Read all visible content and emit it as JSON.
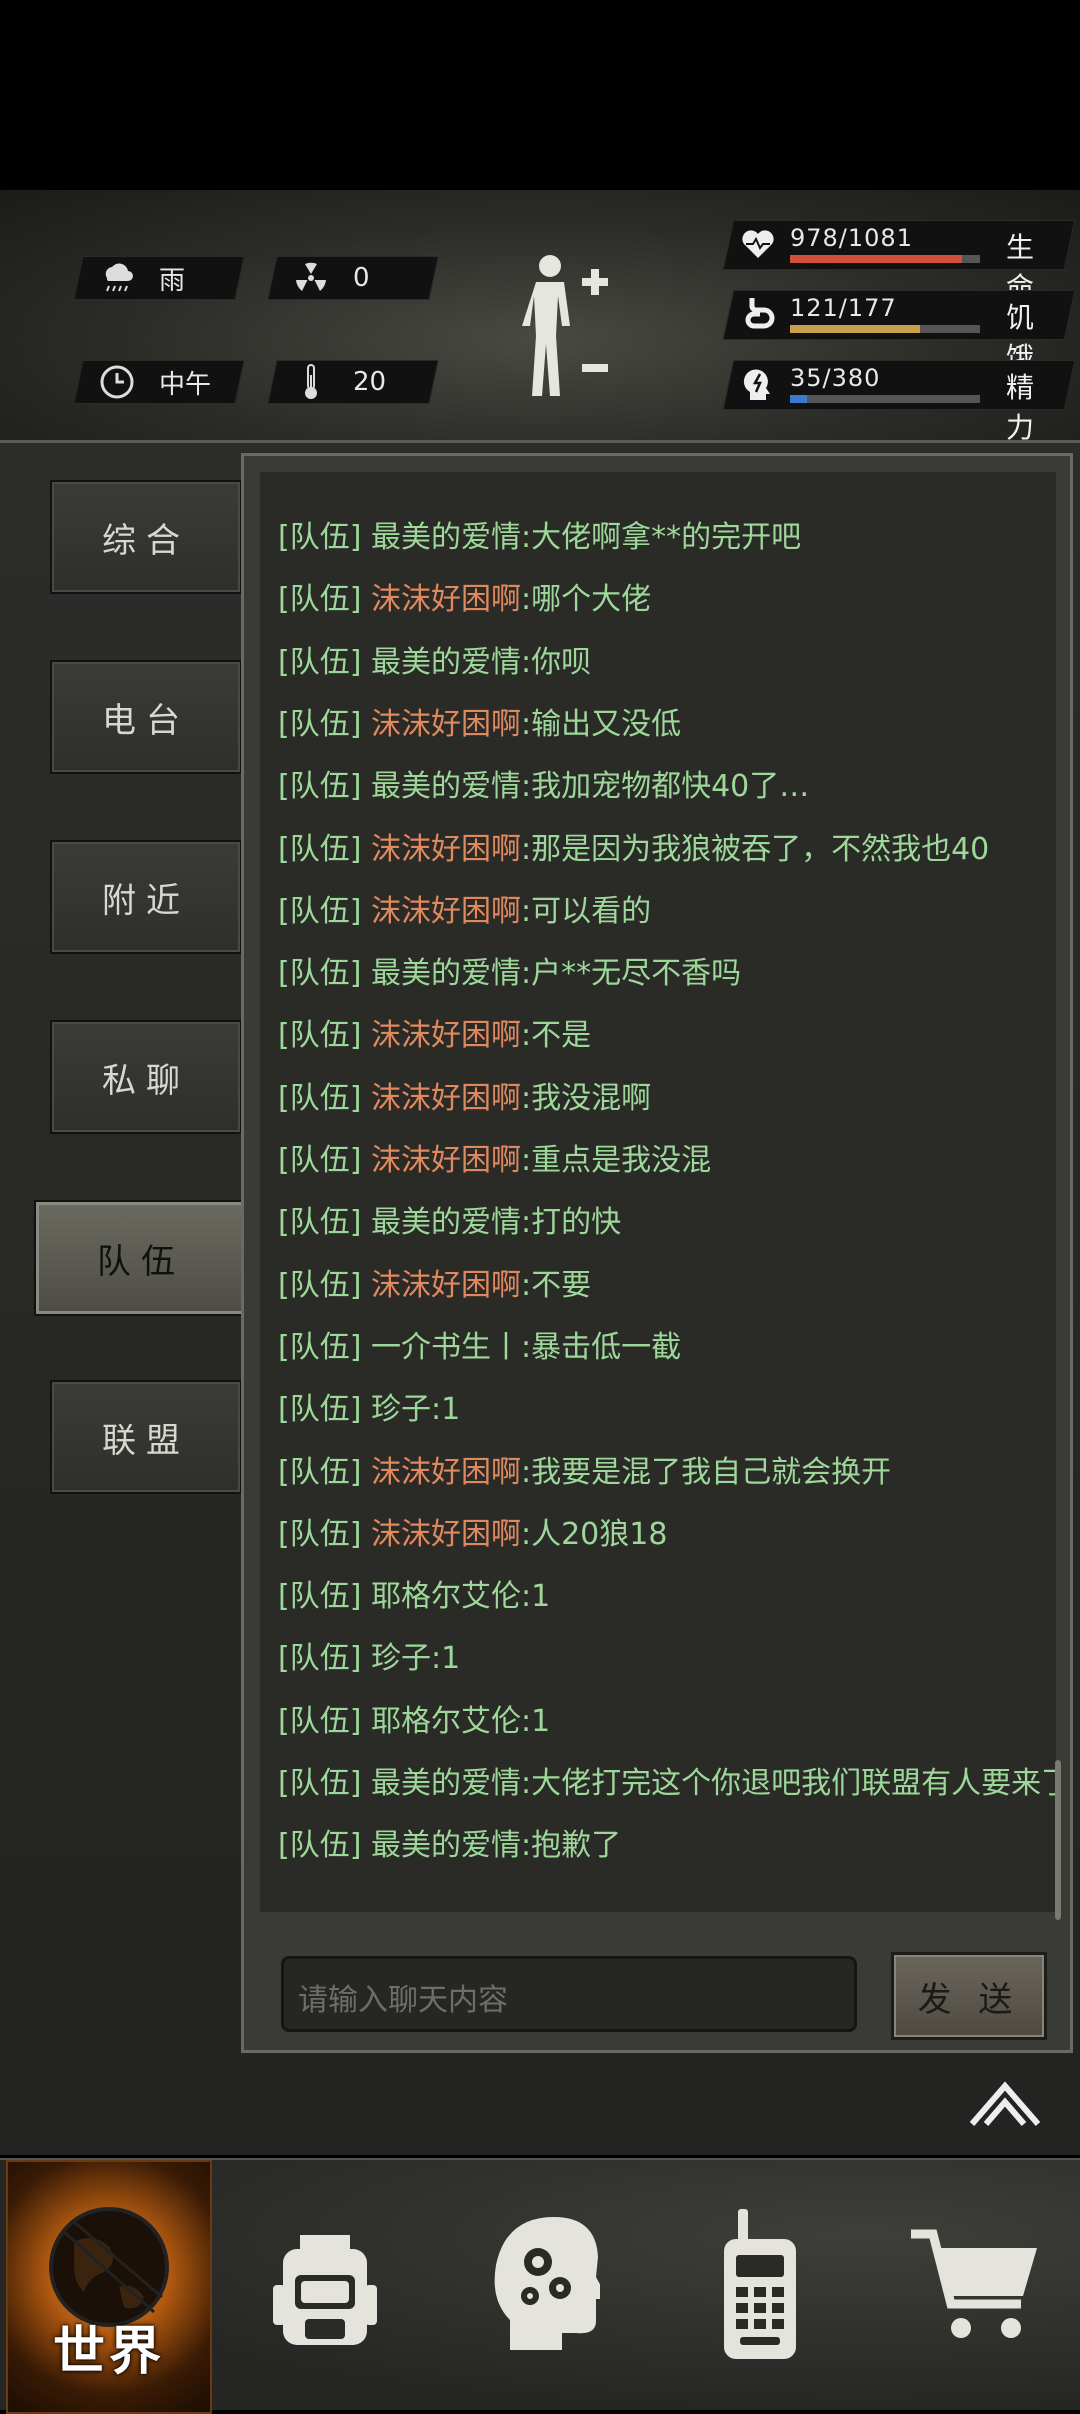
{
  "hud": {
    "weather": "雨",
    "radiation": "0",
    "time_of_day": "中午",
    "temperature": "20",
    "stats": [
      {
        "value": "978/1081",
        "label": "生命",
        "fraction": 0.905,
        "color": "#d0503a",
        "icon": "heart-icon"
      },
      {
        "value": "121/177",
        "label": "饥饿",
        "fraction": 0.684,
        "color": "#c9a04c",
        "icon": "stomach-icon"
      },
      {
        "value": "35/380",
        "label": "精力",
        "fraction": 0.092,
        "color": "#3a7bd0",
        "icon": "energy-head-icon"
      }
    ]
  },
  "tabs": [
    "综合",
    "电台",
    "附近",
    "私聊",
    "队伍",
    "联盟"
  ],
  "active_tab": "队伍",
  "messages": [
    {
      "channel": "[队伍]",
      "name": "最美的爱情",
      "text": ":大佬啊拿**的完开吧",
      "name_color": "green"
    },
    {
      "channel": "[队伍]",
      "name": "沫沫好困啊",
      "text": ":哪个大佬",
      "name_color": "orange"
    },
    {
      "channel": "[队伍]",
      "name": "最美的爱情",
      "text": ":你呗",
      "name_color": "green"
    },
    {
      "channel": "[队伍]",
      "name": "沫沫好困啊",
      "text": ":输出又没低",
      "name_color": "orange"
    },
    {
      "channel": "[队伍]",
      "name": "最美的爱情",
      "text": ":我加宠物都快40了…",
      "name_color": "green"
    },
    {
      "channel": "[队伍]",
      "name": "沫沫好困啊",
      "text": ":那是因为我狼被吞了，不然我也40",
      "name_color": "orange"
    },
    {
      "channel": "[队伍]",
      "name": "沫沫好困啊",
      "text": ":可以看的",
      "name_color": "orange"
    },
    {
      "channel": "[队伍]",
      "name": "最美的爱情",
      "text": ":户**无尽不香吗",
      "name_color": "green"
    },
    {
      "channel": "[队伍]",
      "name": "沫沫好困啊",
      "text": ":不是",
      "name_color": "orange"
    },
    {
      "channel": "[队伍]",
      "name": "沫沫好困啊",
      "text": ":我没混啊",
      "name_color": "orange"
    },
    {
      "channel": "[队伍]",
      "name": "沫沫好困啊",
      "text": ":重点是我没混",
      "name_color": "orange"
    },
    {
      "channel": "[队伍]",
      "name": "最美的爱情",
      "text": ":打的快",
      "name_color": "green"
    },
    {
      "channel": "[队伍]",
      "name": "沫沫好困啊",
      "text": ":不要",
      "name_color": "orange"
    },
    {
      "channel": "[队伍]",
      "name": "一介书生丨",
      "text": ":暴击低一截",
      "name_color": "green"
    },
    {
      "channel": "[队伍]",
      "name": "珍子",
      "text": ":1",
      "name_color": "green"
    },
    {
      "channel": "[队伍]",
      "name": "沫沫好困啊",
      "text": ":我要是混了我自己就会换开",
      "name_color": "orange"
    },
    {
      "channel": "[队伍]",
      "name": "沫沫好困啊",
      "text": ":人20狼18",
      "name_color": "orange"
    },
    {
      "channel": "[队伍]",
      "name": "耶格尔艾伦",
      "text": ":1",
      "name_color": "green"
    },
    {
      "channel": "[队伍]",
      "name": "珍子",
      "text": ":1",
      "name_color": "green"
    },
    {
      "channel": "[队伍]",
      "name": "耶格尔艾伦",
      "text": ":1",
      "name_color": "green"
    },
    {
      "channel": "[队伍]",
      "name": "最美的爱情",
      "text": ":大佬打完这个你退吧我们联盟有人要来了",
      "name_color": "green"
    },
    {
      "channel": "[队伍]",
      "name": "最美的爱情",
      "text": ":抱歉了",
      "name_color": "green"
    }
  ],
  "input": {
    "placeholder": "请输入聊天内容",
    "value": ""
  },
  "send_label": "发 送",
  "bottom_nav": [
    {
      "label": "世界",
      "icon": "globe-icon"
    },
    {
      "icon": "backpack-icon"
    },
    {
      "icon": "head-gears-icon"
    },
    {
      "icon": "walkie-talkie-icon"
    },
    {
      "icon": "shopping-cart-icon"
    }
  ]
}
